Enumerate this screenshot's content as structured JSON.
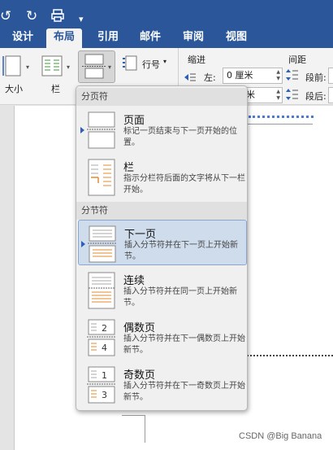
{
  "quick_access": {
    "undo_icon": "undo-icon",
    "redo_icon": "redo-icon",
    "print_icon": "print-icon",
    "customize_icon": "customize-icon"
  },
  "tabs": [
    {
      "label": "设计"
    },
    {
      "label": "布局"
    },
    {
      "label": "引用"
    },
    {
      "label": "邮件"
    },
    {
      "label": "审阅"
    },
    {
      "label": "视图"
    }
  ],
  "ribbon": {
    "size_label": "大小",
    "columns_label": "栏",
    "line_numbers_label": "行号",
    "indent_title": "缩进",
    "spacing_title": "间距",
    "left_label": "左:",
    "left_value": "0 厘米",
    "right_value": "米",
    "before_label": "段前:",
    "after_label": "段后:"
  },
  "menu": {
    "page_breaks_header": "分页符",
    "section_breaks_header": "分节符",
    "items": [
      {
        "title": "页面",
        "desc": "标记一页结束与下一页开始的位置。"
      },
      {
        "title": "栏",
        "desc": "指示分栏符后面的文字将从下一栏开始。"
      },
      {
        "title": "下一页",
        "desc": "插入分节符并在下一页上开始新节。"
      },
      {
        "title": "连续",
        "desc": "插入分节符并在同一页上开始新节。"
      },
      {
        "title": "偶数页",
        "desc": "插入分节符并在下一偶数页上开始新节。",
        "icon_numbers": [
          "2",
          "4"
        ]
      },
      {
        "title": "奇数页",
        "desc": "插入分节符并在下一奇数页上开始新节。",
        "icon_numbers": [
          "1",
          "3"
        ]
      }
    ]
  },
  "watermark": "CSDN @Big Banana",
  "colors": {
    "ribbon_blue": "#2b579a",
    "selection": "#cfdcec",
    "accent_orange": "#e58b2e"
  }
}
